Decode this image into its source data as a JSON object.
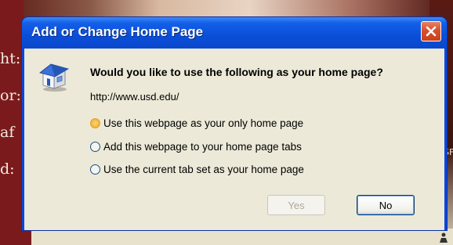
{
  "background": {
    "text_fragments": [
      "ht:",
      "or:",
      "af",
      "d:"
    ],
    "side_glyph": "SF"
  },
  "dialog": {
    "title": "Add or Change Home Page",
    "icon": "house-icon",
    "question": "Would you like to use the following as your home page?",
    "url": "http://www.usd.edu/",
    "options": [
      {
        "label": "Use this webpage as your only home page",
        "selected": true
      },
      {
        "label": "Add this webpage to your home page tabs",
        "selected": false
      },
      {
        "label": "Use the current tab set as your home page",
        "selected": false
      }
    ],
    "buttons": {
      "yes_label": "Yes",
      "no_label": "No"
    },
    "title_color": "#0a4ed8",
    "close_color": "#d8502c"
  }
}
